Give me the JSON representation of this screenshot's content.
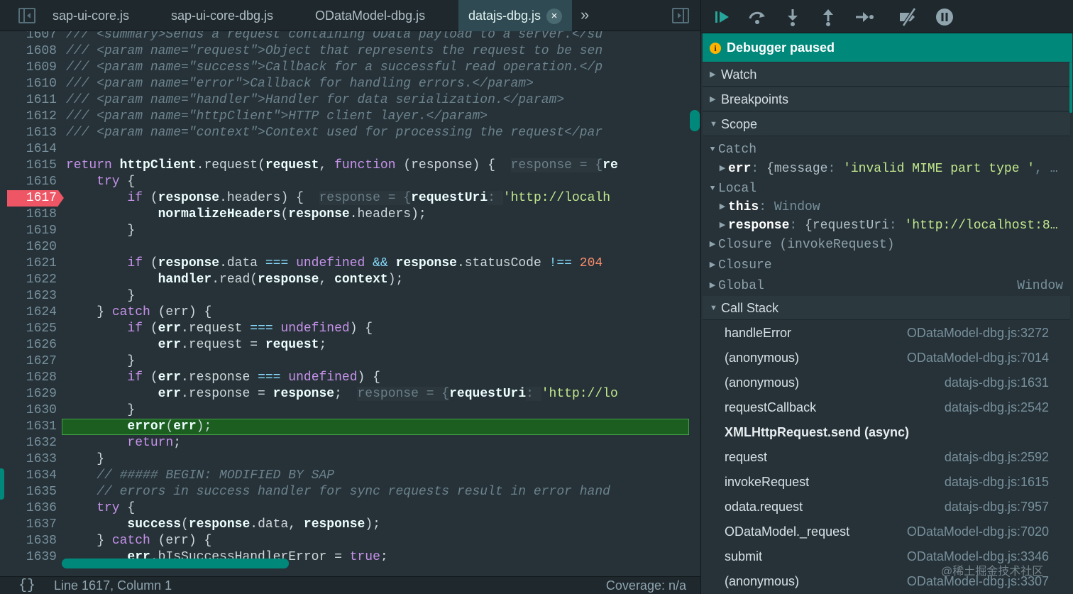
{
  "tabs": [
    {
      "label": "sap-ui-core.js"
    },
    {
      "label": "sap-ui-core-dbg.js"
    },
    {
      "label": "ODataModel-dbg.js"
    },
    {
      "label": "datajs-dbg.js",
      "active": true,
      "close": "×"
    }
  ],
  "tabbar": {
    "more": "»",
    "left_icon": "sidebar-toggle-icon",
    "right_icon": "sidebar-toggle-icon"
  },
  "editor": {
    "breakpoint_line": "1617",
    "current_line": "1631",
    "lines": [
      {
        "n": "1607",
        "tokens": [
          {
            "t": "/// <summary>Sends a request containing OData payload to a server.</su",
            "c": "cm"
          }
        ]
      },
      {
        "n": "1608",
        "tokens": [
          {
            "t": "/// <param name=\"request\">Object that represents the request to be sen",
            "c": "cm"
          }
        ]
      },
      {
        "n": "1609",
        "tokens": [
          {
            "t": "/// <param name=\"success\">Callback for a successful read operation.</p",
            "c": "cm"
          }
        ]
      },
      {
        "n": "1610",
        "tokens": [
          {
            "t": "/// <param name=\"error\">Callback for handling errors.</param>",
            "c": "cm"
          }
        ]
      },
      {
        "n": "1611",
        "tokens": [
          {
            "t": "/// <param name=\"handler\">Handler for data serialization.</param>",
            "c": "cm"
          }
        ]
      },
      {
        "n": "1612",
        "tokens": [
          {
            "t": "/// <param name=\"httpClient\">HTTP client layer.</param>",
            "c": "cm"
          }
        ]
      },
      {
        "n": "1613",
        "tokens": [
          {
            "t": "/// <param name=\"context\">Context used for processing the request</par",
            "c": "cm"
          }
        ]
      },
      {
        "n": "1614",
        "tokens": []
      },
      {
        "n": "1615",
        "tokens": [
          {
            "t": "return ",
            "c": "kw"
          },
          {
            "t": "httpClient",
            "c": "b"
          },
          {
            "t": ".request(",
            "c": "pl"
          },
          {
            "t": "request",
            "c": "b"
          },
          {
            "t": ", ",
            "c": "pl"
          },
          {
            "t": "function",
            "c": "kw"
          },
          {
            "t": " (response) {  ",
            "c": "pl"
          },
          {
            "t": "response = {",
            "c": "ev"
          },
          {
            "t": "re",
            "c": "b"
          }
        ]
      },
      {
        "n": "1616",
        "tokens": [
          {
            "t": "    try",
            "c": "kw"
          },
          {
            "t": " {",
            "c": "pl"
          }
        ]
      },
      {
        "n": "1617",
        "tokens": [
          {
            "t": "        if",
            "c": "kw"
          },
          {
            "t": " (",
            "c": "pl"
          },
          {
            "t": "response",
            "c": "b"
          },
          {
            "t": ".headers) {  ",
            "c": "pl"
          },
          {
            "t": "response = {",
            "c": "ev"
          },
          {
            "t": "requestUri",
            "c": "b"
          },
          {
            "t": ": ",
            "c": "ev"
          },
          {
            "t": "'http://localh",
            "c": "st"
          }
        ]
      },
      {
        "n": "1618",
        "tokens": [
          {
            "t": "            normalizeHeaders",
            "c": "b"
          },
          {
            "t": "(",
            "c": "pl"
          },
          {
            "t": "response",
            "c": "b"
          },
          {
            "t": ".headers);",
            "c": "pl"
          }
        ]
      },
      {
        "n": "1619",
        "tokens": [
          {
            "t": "        }",
            "c": "pl"
          }
        ]
      },
      {
        "n": "1620",
        "tokens": []
      },
      {
        "n": "1621",
        "tokens": [
          {
            "t": "        if",
            "c": "kw"
          },
          {
            "t": " (",
            "c": "pl"
          },
          {
            "t": "response",
            "c": "b"
          },
          {
            "t": ".data ",
            "c": "pl"
          },
          {
            "t": "===",
            "c": "op"
          },
          {
            "t": " undefined ",
            "c": "kw"
          },
          {
            "t": "&&",
            "c": "op"
          },
          {
            "t": " ",
            "c": "pl"
          },
          {
            "t": "response",
            "c": "b"
          },
          {
            "t": ".statusCode ",
            "c": "pl"
          },
          {
            "t": "!==",
            "c": "op"
          },
          {
            "t": " 204",
            "c": "nm"
          }
        ]
      },
      {
        "n": "1622",
        "tokens": [
          {
            "t": "            handler",
            "c": "b"
          },
          {
            "t": ".read(",
            "c": "pl"
          },
          {
            "t": "response",
            "c": "b"
          },
          {
            "t": ", ",
            "c": "pl"
          },
          {
            "t": "context",
            "c": "b"
          },
          {
            "t": ");",
            "c": "pl"
          }
        ]
      },
      {
        "n": "1623",
        "tokens": [
          {
            "t": "        }",
            "c": "pl"
          }
        ]
      },
      {
        "n": "1624",
        "tokens": [
          {
            "t": "    } ",
            "c": "pl"
          },
          {
            "t": "catch",
            "c": "kw"
          },
          {
            "t": " (err) {",
            "c": "pl"
          }
        ]
      },
      {
        "n": "1625",
        "tokens": [
          {
            "t": "        if",
            "c": "kw"
          },
          {
            "t": " (",
            "c": "pl"
          },
          {
            "t": "err",
            "c": "b"
          },
          {
            "t": ".request ",
            "c": "pl"
          },
          {
            "t": "===",
            "c": "op"
          },
          {
            "t": " undefined",
            "c": "kw"
          },
          {
            "t": ") {",
            "c": "pl"
          }
        ]
      },
      {
        "n": "1626",
        "tokens": [
          {
            "t": "            err",
            "c": "b"
          },
          {
            "t": ".request = ",
            "c": "pl"
          },
          {
            "t": "request",
            "c": "b"
          },
          {
            "t": ";",
            "c": "pl"
          }
        ]
      },
      {
        "n": "1627",
        "tokens": [
          {
            "t": "        }",
            "c": "pl"
          }
        ]
      },
      {
        "n": "1628",
        "tokens": [
          {
            "t": "        if",
            "c": "kw"
          },
          {
            "t": " (",
            "c": "pl"
          },
          {
            "t": "err",
            "c": "b"
          },
          {
            "t": ".response ",
            "c": "pl"
          },
          {
            "t": "===",
            "c": "op"
          },
          {
            "t": " undefined",
            "c": "kw"
          },
          {
            "t": ") {",
            "c": "pl"
          }
        ]
      },
      {
        "n": "1629",
        "tokens": [
          {
            "t": "            err",
            "c": "b"
          },
          {
            "t": ".response = ",
            "c": "pl"
          },
          {
            "t": "response",
            "c": "b"
          },
          {
            "t": ";  ",
            "c": "pl"
          },
          {
            "t": "response = {",
            "c": "ev"
          },
          {
            "t": "requestUri",
            "c": "b"
          },
          {
            "t": ": ",
            "c": "ev"
          },
          {
            "t": "'http://lo",
            "c": "st"
          }
        ]
      },
      {
        "n": "1630",
        "tokens": [
          {
            "t": "        }",
            "c": "pl"
          }
        ]
      },
      {
        "n": "1631",
        "tokens": [
          {
            "t": "        error",
            "c": "b"
          },
          {
            "t": "(",
            "c": "pl"
          },
          {
            "t": "err",
            "c": "b"
          },
          {
            "t": ");",
            "c": "pl"
          }
        ]
      },
      {
        "n": "1632",
        "tokens": [
          {
            "t": "        return",
            "c": "kw"
          },
          {
            "t": ";",
            "c": "pl"
          }
        ]
      },
      {
        "n": "1633",
        "tokens": [
          {
            "t": "    }",
            "c": "pl"
          }
        ]
      },
      {
        "n": "1634",
        "tokens": [
          {
            "t": "    // ##### BEGIN: MODIFIED BY SAP",
            "c": "cm"
          }
        ]
      },
      {
        "n": "1635",
        "tokens": [
          {
            "t": "    // errors in success handler for sync requests result in error hand",
            "c": "cm"
          }
        ]
      },
      {
        "n": "1636",
        "tokens": [
          {
            "t": "    try",
            "c": "kw"
          },
          {
            "t": " {",
            "c": "pl"
          }
        ]
      },
      {
        "n": "1637",
        "tokens": [
          {
            "t": "        success",
            "c": "b"
          },
          {
            "t": "(",
            "c": "pl"
          },
          {
            "t": "response",
            "c": "b"
          },
          {
            "t": ".data, ",
            "c": "pl"
          },
          {
            "t": "response",
            "c": "b"
          },
          {
            "t": ");",
            "c": "pl"
          }
        ]
      },
      {
        "n": "1638",
        "tokens": [
          {
            "t": "    } ",
            "c": "pl"
          },
          {
            "t": "catch",
            "c": "kw"
          },
          {
            "t": " (err) {",
            "c": "pl"
          }
        ]
      },
      {
        "n": "1639",
        "tokens": [
          {
            "t": "        err",
            "c": "b"
          },
          {
            "t": ".bIsSuccessHandlerError = ",
            "c": "pl"
          },
          {
            "t": "true",
            "c": "kw"
          },
          {
            "t": ";",
            "c": "pl"
          }
        ]
      }
    ]
  },
  "status": {
    "pretty_print": "{}",
    "cursor": "Line 1617, Column 1",
    "coverage": "Coverage: n/a"
  },
  "debugger": {
    "toolbar": [
      "resume-icon",
      "step-over-icon",
      "step-into-icon",
      "step-out-icon",
      "step-icon",
      "deactivate-breakpoints-icon",
      "pause-on-exceptions-icon"
    ],
    "banner": {
      "icon": "i",
      "text": "Debugger paused"
    },
    "panes": {
      "watch": "Watch",
      "breakpoints": "Breakpoints",
      "scope": "Scope",
      "call_stack": "Call Stack"
    },
    "scope": {
      "catch_label": "Catch",
      "err_key": "err",
      "err_sep": ": ",
      "err_open": "{",
      "err_prop": "message",
      "err_prop_sep": ": ",
      "err_value": "'invalid MIME part type '",
      "err_tail": ", …",
      "local_label": "Local",
      "this_key": "this",
      "this_sep": ": ",
      "this_value": "Window",
      "response_key": "response",
      "response_sep": ": ",
      "response_open": "{",
      "response_prop": "requestUri",
      "response_prop_sep": ": ",
      "response_value": "'http://localhost:8…",
      "closure_invoke": "Closure (invokeRequest)",
      "closure": "Closure",
      "global": "Global",
      "global_value": "Window"
    },
    "call_stack": [
      {
        "fn": "handleError",
        "loc": "ODataModel-dbg.js:3272"
      },
      {
        "fn": "(anonymous)",
        "loc": "ODataModel-dbg.js:7014"
      },
      {
        "fn": "(anonymous)",
        "loc": "datajs-dbg.js:1631"
      },
      {
        "fn": "requestCallback",
        "loc": "datajs-dbg.js:2542"
      },
      {
        "fn": "XMLHttpRequest.send (async)",
        "loc": "",
        "async": true
      },
      {
        "fn": "request",
        "loc": "datajs-dbg.js:2592"
      },
      {
        "fn": "invokeRequest",
        "loc": "datajs-dbg.js:1615"
      },
      {
        "fn": "odata.request",
        "loc": "datajs-dbg.js:7957"
      },
      {
        "fn": "ODataModel._request",
        "loc": "ODataModel-dbg.js:7020"
      },
      {
        "fn": "submit",
        "loc": "ODataModel-dbg.js:3346"
      },
      {
        "fn": "(anonymous)",
        "loc": "ODataModel-dbg.js:3307"
      }
    ],
    "watermark": "@稀土掘金技术社区"
  },
  "colors": {
    "accent": "#00897b",
    "breakpoint": "#ef5665",
    "current_line": "#1b5e20",
    "banner": "#00897b"
  }
}
